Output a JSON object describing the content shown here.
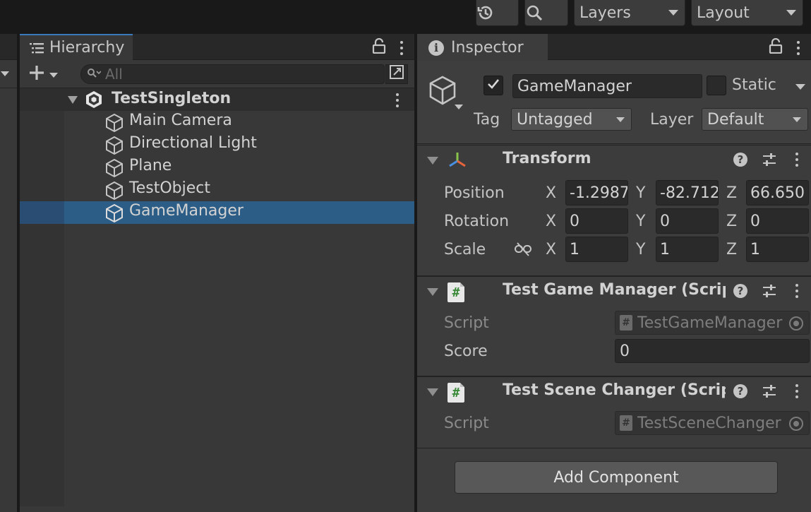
{
  "toolbar": {
    "layers_label": "Layers",
    "layout_label": "Layout",
    "history_icon": "history-icon",
    "search_icon": "search-icon"
  },
  "hierarchy": {
    "tab_label": "Hierarchy",
    "search_placeholder": "All",
    "scene_name": "TestSingleton",
    "items": [
      {
        "label": "Main Camera",
        "selected": false
      },
      {
        "label": "Directional Light",
        "selected": false
      },
      {
        "label": "Plane",
        "selected": false
      },
      {
        "label": "TestObject",
        "selected": false
      },
      {
        "label": "GameManager",
        "selected": true
      }
    ]
  },
  "inspector": {
    "tab_label": "Inspector",
    "object_name": "GameManager",
    "active": true,
    "static_label": "Static",
    "tag_label": "Tag",
    "tag_value": "Untagged",
    "layer_label": "Layer",
    "layer_value": "Default",
    "transform": {
      "title": "Transform",
      "position_label": "Position",
      "rotation_label": "Rotation",
      "scale_label": "Scale",
      "axes": [
        "X",
        "Y",
        "Z"
      ],
      "position": [
        "-1.2987",
        "-82.712",
        "66.650"
      ],
      "rotation": [
        "0",
        "0",
        "0"
      ],
      "scale": [
        "1",
        "1",
        "1"
      ]
    },
    "components": [
      {
        "title": "Test Game Manager (Script)",
        "script_label": "Script",
        "script_value": "TestGameManager",
        "score_label": "Score",
        "score_value": "0"
      },
      {
        "title": "Test Scene Changer (Script)",
        "script_label": "Script",
        "script_value": "TestSceneChanger"
      }
    ],
    "add_component_label": "Add Component"
  },
  "colors": {
    "selection": "#2c5d87",
    "tab_accent": "#3a79bb",
    "panel_bg": "#383838",
    "inspector_bg": "#3c3c3c",
    "script_hash": "#3a8a3a"
  }
}
